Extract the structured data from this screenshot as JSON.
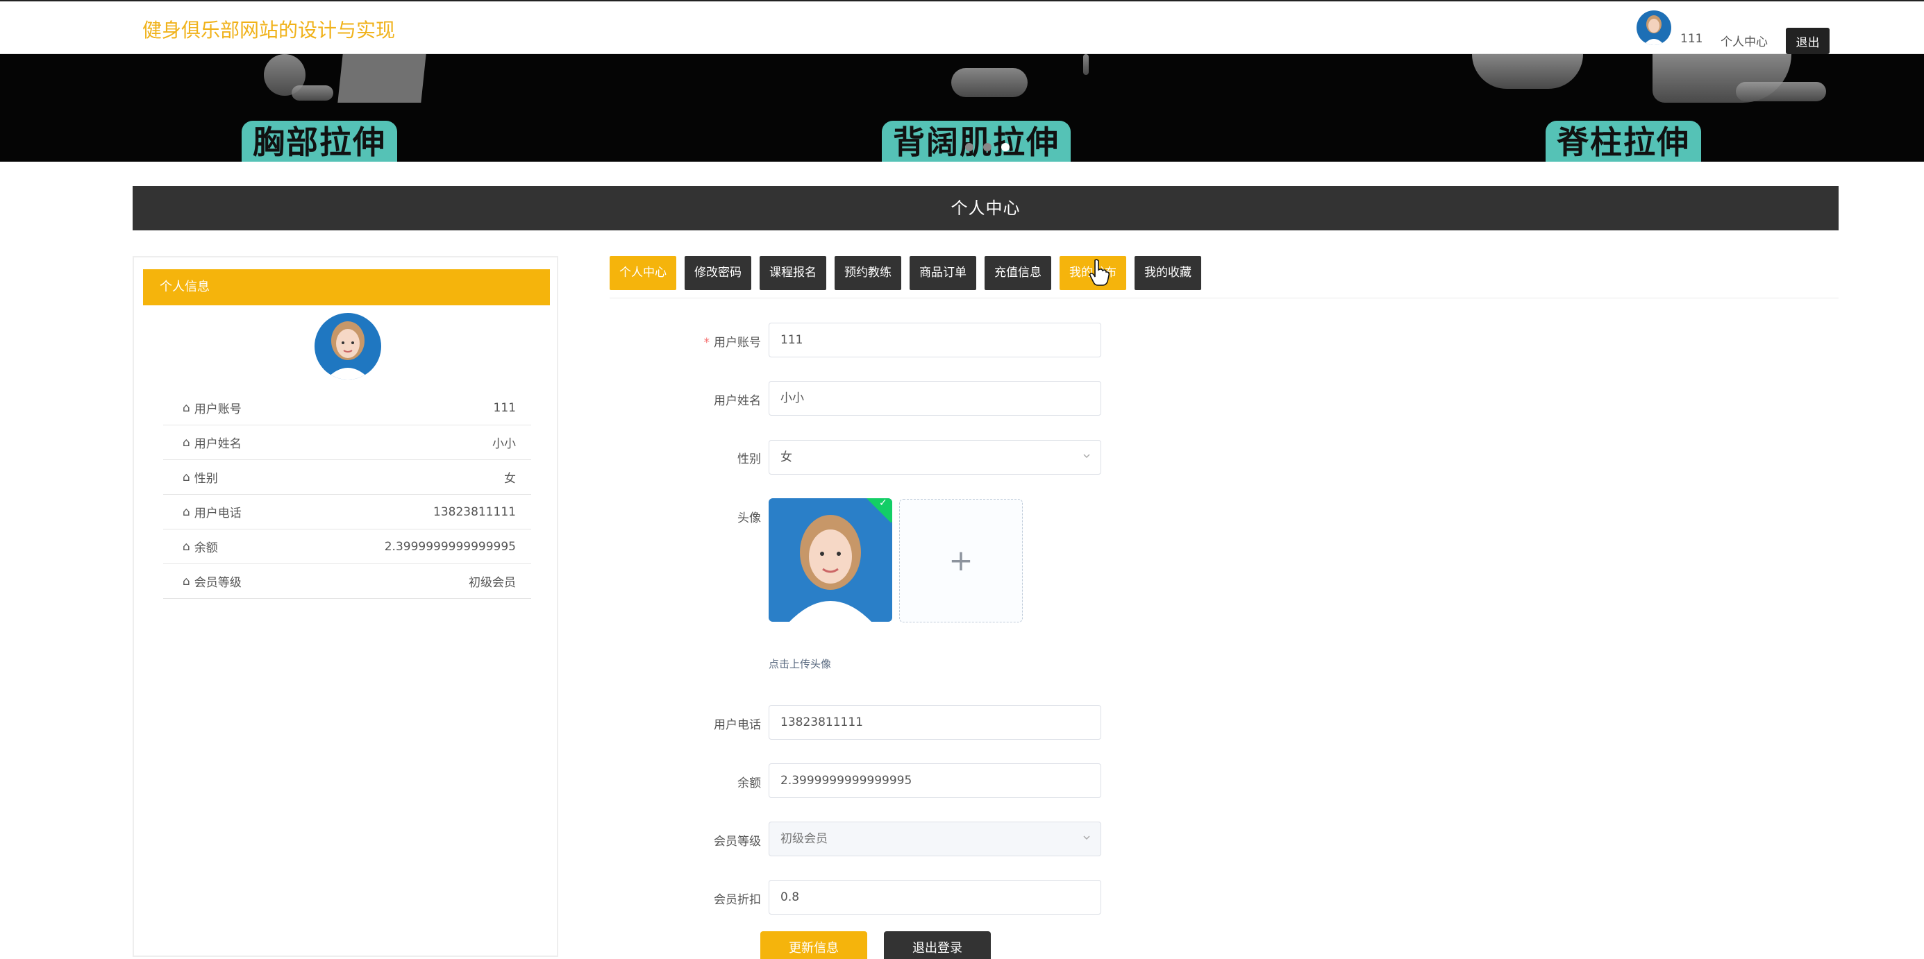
{
  "header": {
    "site_title": "健身俱乐部网站的设计与实现",
    "username": "111",
    "personal_center": "个人中心",
    "logout": "退出"
  },
  "banner": {
    "labels": [
      "胸部拉伸",
      "背阔肌拉伸",
      "脊柱拉伸"
    ],
    "slides": 3,
    "active_slide": 3
  },
  "section_title": "个人中心",
  "sidebar": {
    "title": "个人信息",
    "items": [
      {
        "label": "用户账号",
        "value": "111"
      },
      {
        "label": "用户姓名",
        "value": "小小"
      },
      {
        "label": "性别",
        "value": "女"
      },
      {
        "label": "用户电话",
        "value": "13823811111"
      },
      {
        "label": "余额",
        "value": "2.3999999999999995"
      },
      {
        "label": "会员等级",
        "value": "初级会员"
      }
    ]
  },
  "tabs": [
    {
      "label": "个人中心",
      "active": true
    },
    {
      "label": "修改密码",
      "active": false
    },
    {
      "label": "课程报名",
      "active": false
    },
    {
      "label": "预约教练",
      "active": false
    },
    {
      "label": "商品订单",
      "active": false
    },
    {
      "label": "充值信息",
      "active": false
    },
    {
      "label": "我的发布",
      "active": false
    },
    {
      "label": "我的收藏",
      "active": false
    }
  ],
  "form": {
    "account": {
      "label": "用户账号",
      "required_mark": "*",
      "value": "111"
    },
    "name": {
      "label": "用户姓名",
      "value": "小小"
    },
    "gender": {
      "label": "性别",
      "value": "女"
    },
    "avatar": {
      "label": "头像",
      "tip": "点击上传头像"
    },
    "phone": {
      "label": "用户电话",
      "value": "13823811111"
    },
    "balance": {
      "label": "余额",
      "value": "2.3999999999999995"
    },
    "level": {
      "label": "会员等级",
      "value": "初级会员"
    },
    "discount": {
      "label": "会员折扣",
      "value": "0.8"
    },
    "update_button": "更新信息",
    "logout_button": "退出登录"
  },
  "colors": {
    "accent": "#f5b40c",
    "dark": "#333333",
    "title": "#f0b21a"
  }
}
